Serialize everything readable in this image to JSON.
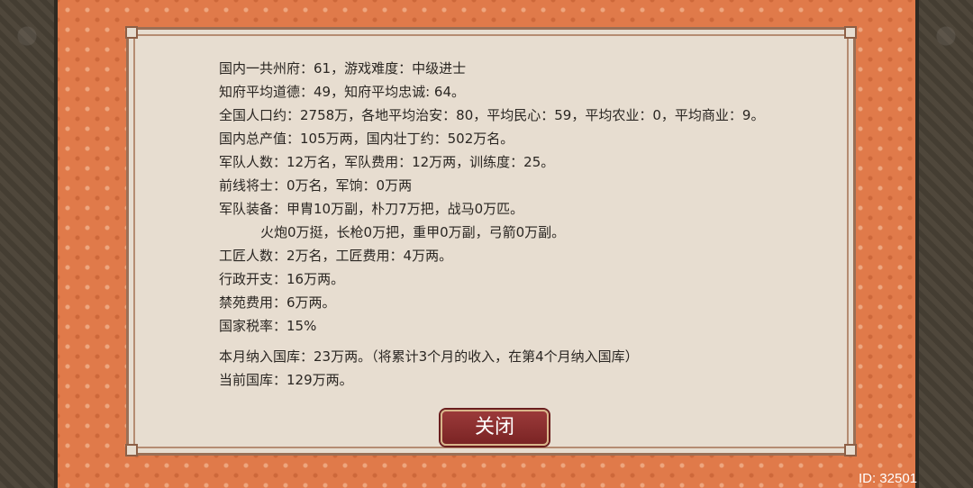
{
  "report": {
    "lines": [
      "国内一共州府：61，游戏难度：中级进士",
      "知府平均道德：49，知府平均忠诚: 64。",
      "全国人口约：2758万，各地平均治安：80，平均民心：59，平均农业：0，平均商业：9。",
      "国内总产值：105万两，国内壮丁约：502万名。",
      "军队人数：12万名，军队费用：12万两，训练度：25。",
      "前线将士：0万名，军饷：0万两",
      "军队装备：甲胄10万副，朴刀7万把，战马0万匹。",
      "火炮0万挺，长枪0万把，重甲0万副，弓箭0万副。",
      "工匠人数：2万名，工匠费用：4万两。",
      "行政开支：16万两。",
      "禁苑费用：6万两。",
      "国家税率：15%",
      "本月纳入国库：23万两。（将累计3个月的收入，在第4个月纳入国库）",
      "当前国库：129万两。"
    ]
  },
  "buttons": {
    "close_label": "关闭"
  },
  "footer": {
    "id_text": "ID: 32501"
  },
  "colors": {
    "frame": "#e07a4a",
    "panel": "#e7ddd0",
    "button": "#8a2e2e"
  }
}
